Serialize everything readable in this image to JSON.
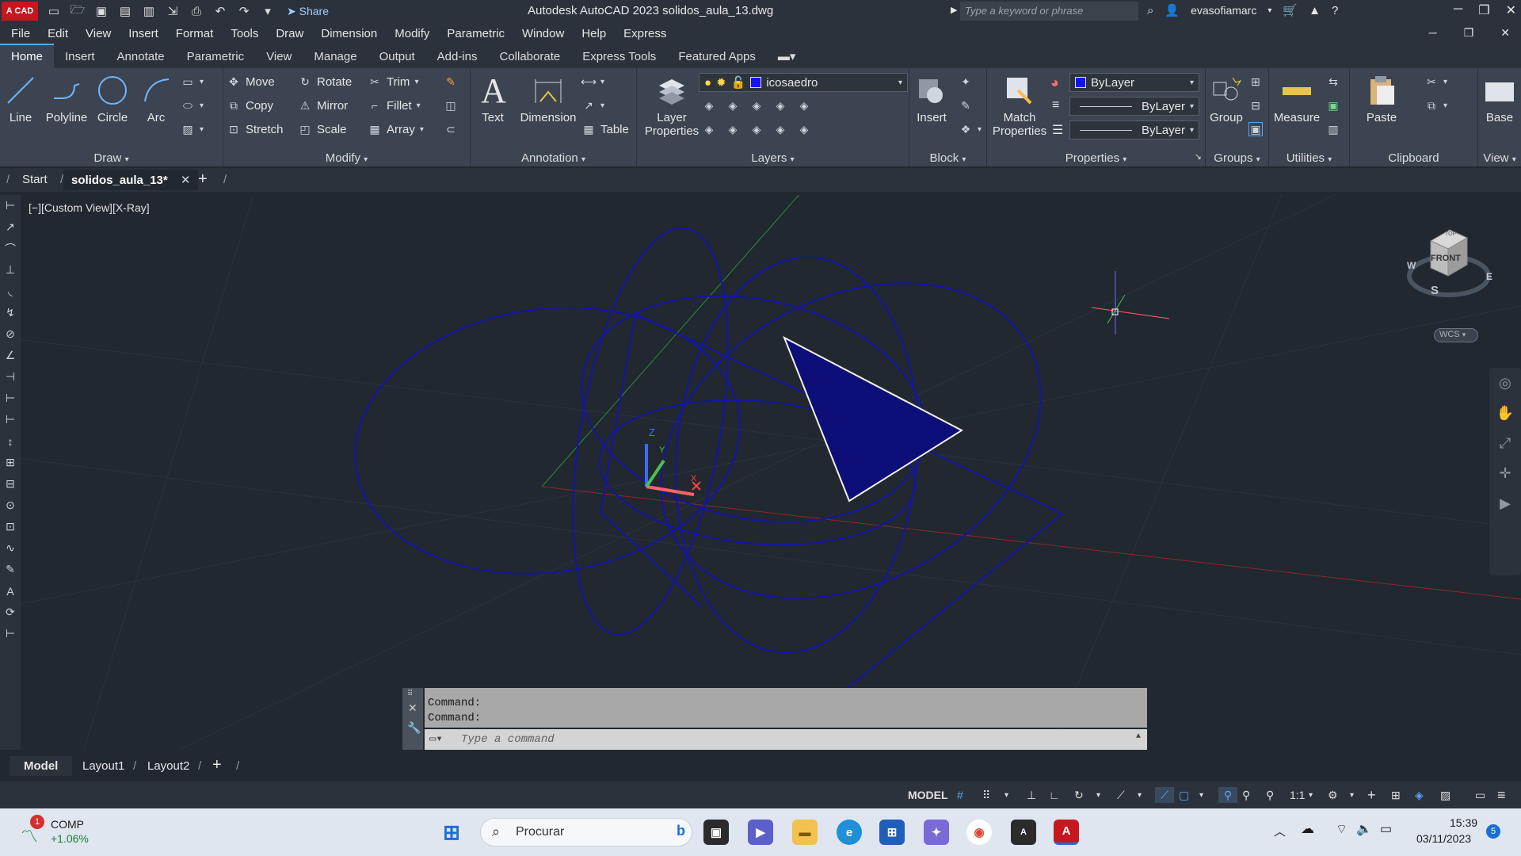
{
  "app": {
    "logo_text": "A CAD",
    "title": "Autodesk AutoCAD 2023    solidos_aula_13.dwg",
    "share_label": "Share",
    "search_placeholder": "Type a keyword or phrase",
    "username": "evasofiamarc"
  },
  "menubar": [
    "File",
    "Edit",
    "View",
    "Insert",
    "Format",
    "Tools",
    "Draw",
    "Dimension",
    "Modify",
    "Parametric",
    "Window",
    "Help",
    "Express"
  ],
  "ribbon_tabs": [
    "Home",
    "Insert",
    "Annotate",
    "Parametric",
    "View",
    "Manage",
    "Output",
    "Add-ins",
    "Collaborate",
    "Express Tools",
    "Featured Apps"
  ],
  "ribbon": {
    "draw": {
      "title": "Draw",
      "line": "Line",
      "polyline": "Polyline",
      "circle": "Circle",
      "arc": "Arc"
    },
    "modify": {
      "title": "Modify",
      "move": "Move",
      "rotate": "Rotate",
      "trim": "Trim",
      "copy": "Copy",
      "mirror": "Mirror",
      "fillet": "Fillet",
      "stretch": "Stretch",
      "scale": "Scale",
      "array": "Array"
    },
    "annotation": {
      "title": "Annotation",
      "text": "Text",
      "dimension": "Dimension",
      "table": "Table"
    },
    "layers": {
      "title": "Layers",
      "layer_properties_1": "Layer",
      "layer_properties_2": "Properties",
      "current_layer": "icosaedro"
    },
    "block": {
      "title": "Block",
      "insert": "Insert"
    },
    "properties": {
      "title": "Properties",
      "match_1": "Match",
      "match_2": "Properties",
      "color": "ByLayer",
      "linetype": "ByLayer",
      "lineweight": "ByLayer"
    },
    "groups": {
      "title": "Groups",
      "group": "Group"
    },
    "utilities": {
      "title": "Utilities",
      "measure": "Measure"
    },
    "clipboard": {
      "title": "Clipboard",
      "paste": "Paste"
    },
    "view": {
      "title": "View",
      "base": "Base"
    }
  },
  "file_tabs": {
    "start": "Start",
    "current": "solidos_aula_13*"
  },
  "viewport": {
    "label": "[−][Custom View][X-Ray]",
    "viewcube_top": "TOP",
    "viewcube_front": "FRONT",
    "compass_w": "W",
    "compass_e": "E",
    "compass_s": "S",
    "wcs": "WCS",
    "ucs_z": "Z",
    "ucs_y": "Y",
    "ucs_x": "X"
  },
  "command": {
    "history": [
      "Command:",
      "Command:"
    ],
    "placeholder": "Type a command"
  },
  "layout_tabs": [
    "Model",
    "Layout1",
    "Layout2"
  ],
  "status": {
    "model": "MODEL",
    "scale": "1:1"
  },
  "taskbar": {
    "stock_name": "COMP",
    "stock_change": "+1.06%",
    "stock_badge": "1",
    "search": "Procurar",
    "time": "15:39",
    "date": "03/11/2023",
    "notif": "5"
  },
  "colors": {
    "accent": "#56a7ff",
    "layer_color": "#1212ff",
    "drawing_blue": "#1414a8"
  }
}
